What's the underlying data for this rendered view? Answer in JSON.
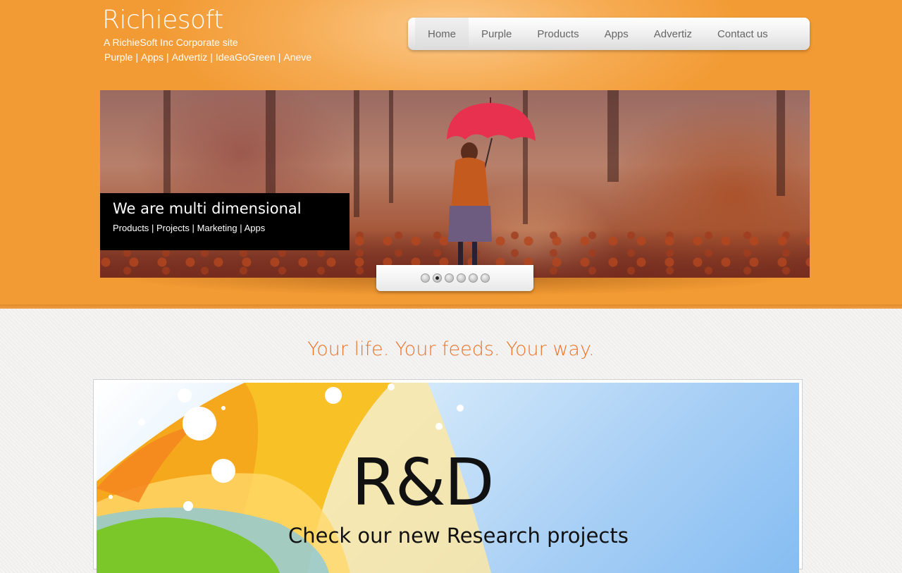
{
  "header": {
    "brand": "Richiesoft",
    "tagline": "A RichieSoft Inc Corporate site",
    "site_links": [
      "Purple",
      "Apps",
      "Advertiz",
      "IdeaGoGreen",
      "Aneve"
    ],
    "separator": "|"
  },
  "nav": {
    "items": [
      {
        "label": "Home",
        "active": true
      },
      {
        "label": "Purple",
        "active": false
      },
      {
        "label": "Products",
        "active": false
      },
      {
        "label": "Apps",
        "active": false
      },
      {
        "label": "Advertiz",
        "active": false
      },
      {
        "label": "Contact us",
        "active": false
      }
    ]
  },
  "slider": {
    "caption_title": "We are multi dimensional",
    "caption_links": [
      "Products",
      "Projects",
      "Marketing",
      "Apps"
    ],
    "slide_count": 6,
    "active_slide": 2
  },
  "slogan": "Your life. Your feeds. Your way.",
  "banner": {
    "title": "R&D",
    "subtitle": "Check our new Research projects"
  },
  "colors": {
    "header_orange": "#f29a33",
    "slogan_orange": "#ec7328",
    "umbrella_red": "#e8304f"
  }
}
